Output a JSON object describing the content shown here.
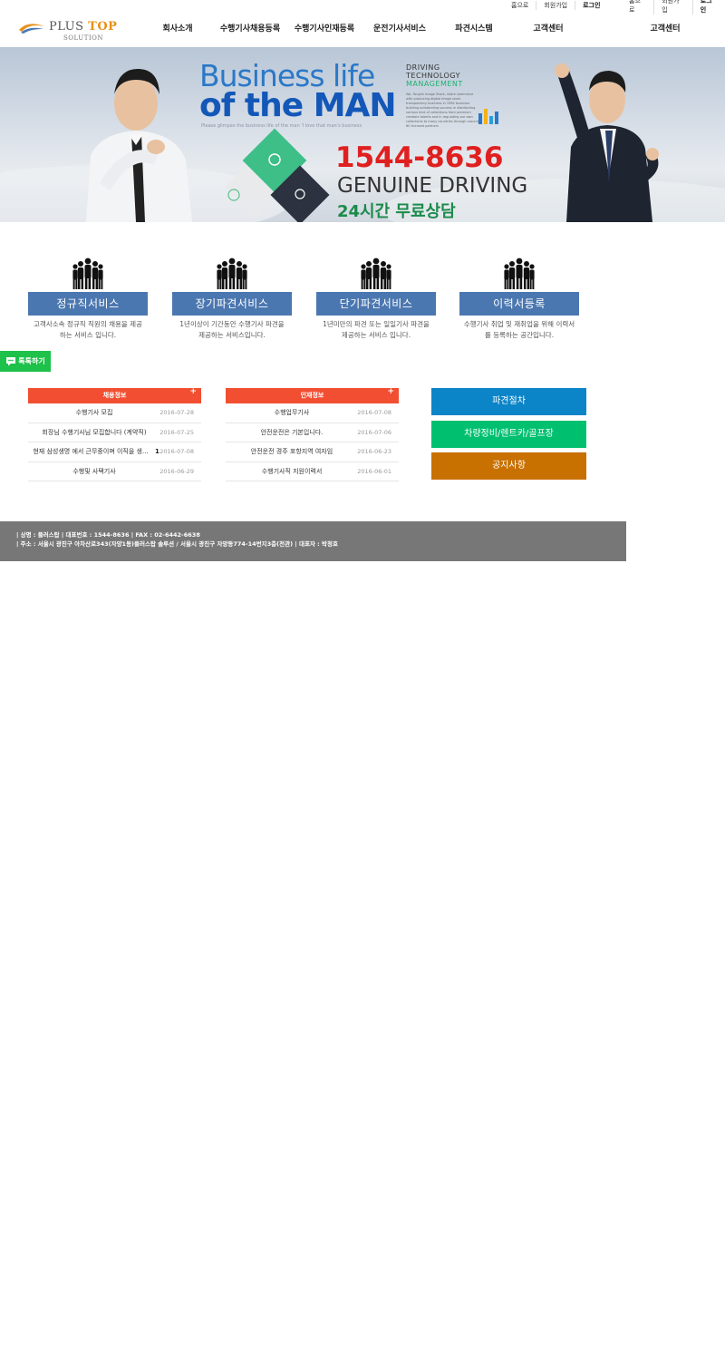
{
  "utility_links": [
    {
      "label": "홈으로"
    },
    {
      "label": "회원가입"
    },
    {
      "label": "로그인"
    },
    {
      "label": "홈으로"
    },
    {
      "label": "회원가입"
    },
    {
      "label": "로그인"
    }
  ],
  "logo": {
    "brand_a": "PLUS ",
    "brand_b": "TOP",
    "sub": "SOLUTION"
  },
  "nav": [
    {
      "label": "회사소개"
    },
    {
      "label": "수행기사채용등록"
    },
    {
      "label": "수행기사인재등록"
    },
    {
      "label": "운전기사서비스"
    },
    {
      "label": "파견시스템"
    },
    {
      "label": "고객센터"
    },
    {
      "label": "고객센터"
    }
  ],
  "banner": {
    "title_line1": "Business life",
    "title_line2": "of the MAN",
    "subtitle": "Please glimpse the business life of the man 'I love that man's business",
    "tech_line1": "DRIVING",
    "tech_line2": "TECHNOLOGY",
    "tech_line3": "MANAGEMENT",
    "tech_desc": "We, Tonglin Image Stock, share commerce with producing digital image stock transparency business in 1962 business building outstanding success in distributing various kind of collections from premium creators talents and in regulating our own collections to many countries through around 60 licensed partners",
    "phone": "1544-8636",
    "tagline": "GENUINE DRIVING",
    "consult": "24시간 무료상담",
    "colors": {
      "phone": "#e02020",
      "consult": "#1a8a4a",
      "title": "#1358b8"
    }
  },
  "services": [
    {
      "label": "정규직서비스",
      "desc": "고객사소속 정규직 직원의 채용을 제공하는 서비스 입니다."
    },
    {
      "label": "장기파견서비스",
      "desc": "1년이상이 기간동안 수행기사 파견을 제공하는 서비스입니다."
    },
    {
      "label": "단기파견서비스",
      "desc": "1년미만의 파견 또는 일일기사 파견을 제공하는 서비스 입니다."
    },
    {
      "label": "이력서등록",
      "desc": "수행기사 취업 및 재취업을 위해 이력서를 등록하는 공간입니다."
    }
  ],
  "talk_button": {
    "label": "톡톡하기",
    "icon": "chat-bubble-icon"
  },
  "boards": [
    {
      "title": "채용정보",
      "more": "+",
      "rows": [
        {
          "title": "수행기사 모집",
          "num": "",
          "date": "2016-07-28"
        },
        {
          "title": "회장님 수행기사님 모집합니다 (계약직)",
          "num": "",
          "date": "2016-07-25"
        },
        {
          "title": "현재 삼성생명 에서 근무중이며 이직을 생...",
          "num": "1",
          "date": "2016-07-08"
        },
        {
          "title": "수행및 사택기사",
          "num": "",
          "date": "2016-06-29"
        }
      ]
    },
    {
      "title": "인재정보",
      "more": "+",
      "rows": [
        {
          "title": "수행업무기사",
          "num": "",
          "date": "2016-07-08"
        },
        {
          "title": "안전운전은 기본입니다.",
          "num": "",
          "date": "2016-07-06"
        },
        {
          "title": "안전운전 경주 포항지역 여자임",
          "num": "",
          "date": "2016-06-23"
        },
        {
          "title": "수행기사직 지원이력서",
          "num": "",
          "date": "2016-06-01"
        }
      ]
    }
  ],
  "right_buttons": [
    {
      "label": "파견절차",
      "color": "#0b84c8"
    },
    {
      "label": "차량정비/렌트카/골프장",
      "color": "#00c070"
    },
    {
      "label": "공지사항",
      "color": "#c87000"
    }
  ],
  "footer": {
    "line1": "| 상명 : 플러스탑 | 대표번호 : 1544-8636 | FAX : 02-6442-6638",
    "line2": "| 주소 : 서울시 광진구 아차산로343(자양1동)플러스탑 솔루션 / 서울시 광진구 자양동774-14번지3층(전관) | 대표자 : 박정호"
  }
}
